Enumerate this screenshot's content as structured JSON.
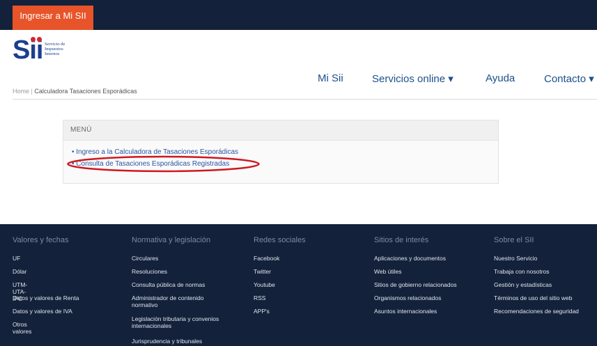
{
  "header": {
    "login_button": "Ingresar a Mi SII",
    "logo_text": "Sii",
    "logo_subtext": [
      "Servicio de",
      "Impuestos",
      "Internos"
    ]
  },
  "nav": {
    "mi_sii": "Mi Sii",
    "servicios": "Servicios online ▾",
    "ayuda": "Ayuda",
    "contacto": "Contacto ▾"
  },
  "breadcrumb": {
    "home": "Home",
    "current": "Calculadora Tasaciones Esporádicas"
  },
  "menu": {
    "title": "MENÚ",
    "items": [
      "• Ingreso a la Calculadora de Tasaciones Esporádicas",
      "• Consulta de Tasaciones Esporádicas Registradas"
    ]
  },
  "footer": {
    "columns": [
      {
        "heading": "Valores y fechas",
        "items": [
          "UF",
          "Dólar",
          "UTM-UTA-IPC",
          "Datos y valores de Renta",
          "Datos y valores de IVA",
          "Otros valores"
        ]
      },
      {
        "heading": "Normativa y legislación",
        "items": [
          "Circulares",
          "Resoluciones",
          "Consulta pública de normas",
          "Administrador de contenido normativo",
          "Legislación tributaria y convenios internacionales",
          "Jurisprudencia y tribunales"
        ]
      },
      {
        "heading": "Redes sociales",
        "items": [
          "Facebook",
          "Twitter",
          "Youtube",
          "RSS",
          "APP's"
        ]
      },
      {
        "heading": "Sitios de interés",
        "items": [
          "Aplicaciones y documentos",
          "Web útiles",
          "Sitios de gobierno relacionados",
          "Organismos relacionados",
          "Asuntos internacionales"
        ]
      },
      {
        "heading": "Sobre el SII",
        "items": [
          "Nuestro Servicio",
          "Trabaja con nosotros",
          "Gestión y estadísticas",
          "Términos de uso del sitio web",
          "Recomendaciones de seguridad"
        ]
      }
    ]
  },
  "colors": {
    "top_bar": "#13213a",
    "login_button": "#e8542a",
    "brand_blue": "#1b3e8f",
    "link_blue": "#2b55a3",
    "annotation_red": "#d0171f"
  }
}
